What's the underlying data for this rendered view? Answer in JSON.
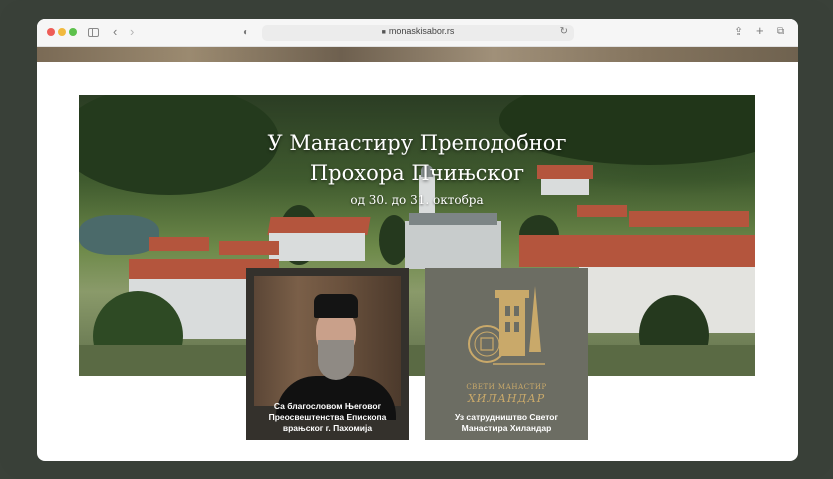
{
  "browser": {
    "url": "monaskisabor.rs",
    "icons": [
      "sidebar-icon",
      "back-icon",
      "forward-icon",
      "shield-icon",
      "lock-icon",
      "reload-icon",
      "share-icon",
      "new-tab-icon",
      "tabs-overview-icon"
    ]
  },
  "hero": {
    "title_line1": "У Манастиру Преподобног",
    "title_line2": "Прохора Пчињског",
    "date": "од 30. до 31. октобра"
  },
  "cards": {
    "bishop": {
      "caption_line1": "Са благословом Његовог",
      "caption_line2": "Преосвештенства Епископа",
      "caption_line3": "врањског г. Пахомија"
    },
    "hilandar": {
      "logo_line1": "СВЕТИ МАНАСТИР",
      "logo_line2": "ХИЛАНДАР",
      "caption_line1": "Уз сатрудништво Светог",
      "caption_line2": "Манастира Хиландар"
    }
  },
  "colors": {
    "frame": "#394038",
    "roof": "#b4553d",
    "hilandar_card": "#6c6d63",
    "hilandar_gold": "#c9a96a"
  }
}
